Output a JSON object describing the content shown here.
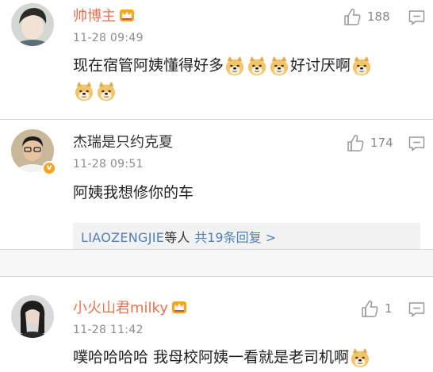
{
  "comments": [
    {
      "username": "帅博主",
      "timestamp": "11-28 09:49",
      "likes": "188",
      "content_text_1": "现在宿管阿姨懂得好多",
      "content_text_2": "好讨厌啊"
    },
    {
      "username": "杰瑞是只约克夏",
      "timestamp": "11-28 09:51",
      "likes": "174",
      "content": "阿姨我想修你的车",
      "verified_badge": "v",
      "replies": {
        "name": "LIAOZENGJIE",
        "suffix": "等人",
        "count_label": "共19条回复 >"
      }
    },
    {
      "username": "小火山君milky",
      "timestamp": "11-28 11:42",
      "likes": "1",
      "content": "噗哈哈哈哈 我母校阿姨一看就是老司机啊"
    }
  ],
  "colors": {
    "vip_name": "#eb7350",
    "link_blue": "#4e82b7",
    "meta_gray": "#8d8d8d"
  },
  "icons": [
    "thumb-up-icon",
    "reply-icon",
    "crown-icon",
    "doge-emoji",
    "verified-icon"
  ]
}
